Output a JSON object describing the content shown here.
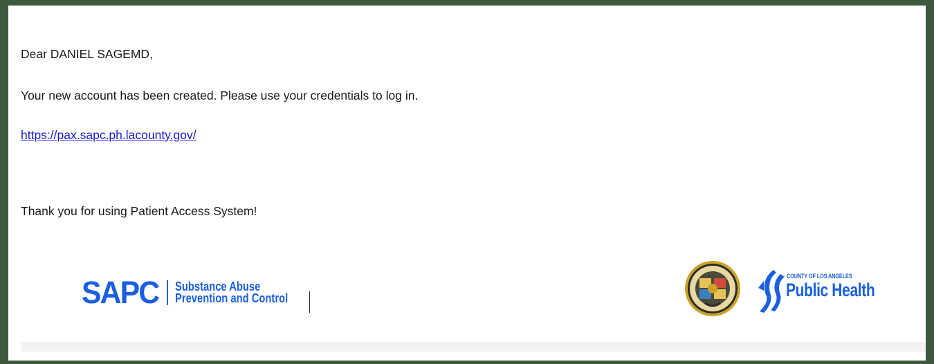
{
  "email": {
    "greeting": "Dear DANIEL SAGEMD,",
    "message": "Your new account has been created. Please use your credentials to log in.",
    "link_text": "https://pax.sapc.ph.lacounty.gov/",
    "closing": "Thank you for using Patient Access System!"
  },
  "logos": {
    "sapc": {
      "acronym": "SAPC",
      "line1": "Substance Abuse",
      "line2": "Prevention and Control"
    },
    "county_seal": {
      "icon": "county-seal-icon"
    },
    "public_health": {
      "small": "COUNTY OF LOS ANGELES",
      "big": "Public Health"
    }
  },
  "colors": {
    "frame": "#3d5a3c",
    "link": "#1a1ad6",
    "brand_blue": "#1a5fe0"
  }
}
